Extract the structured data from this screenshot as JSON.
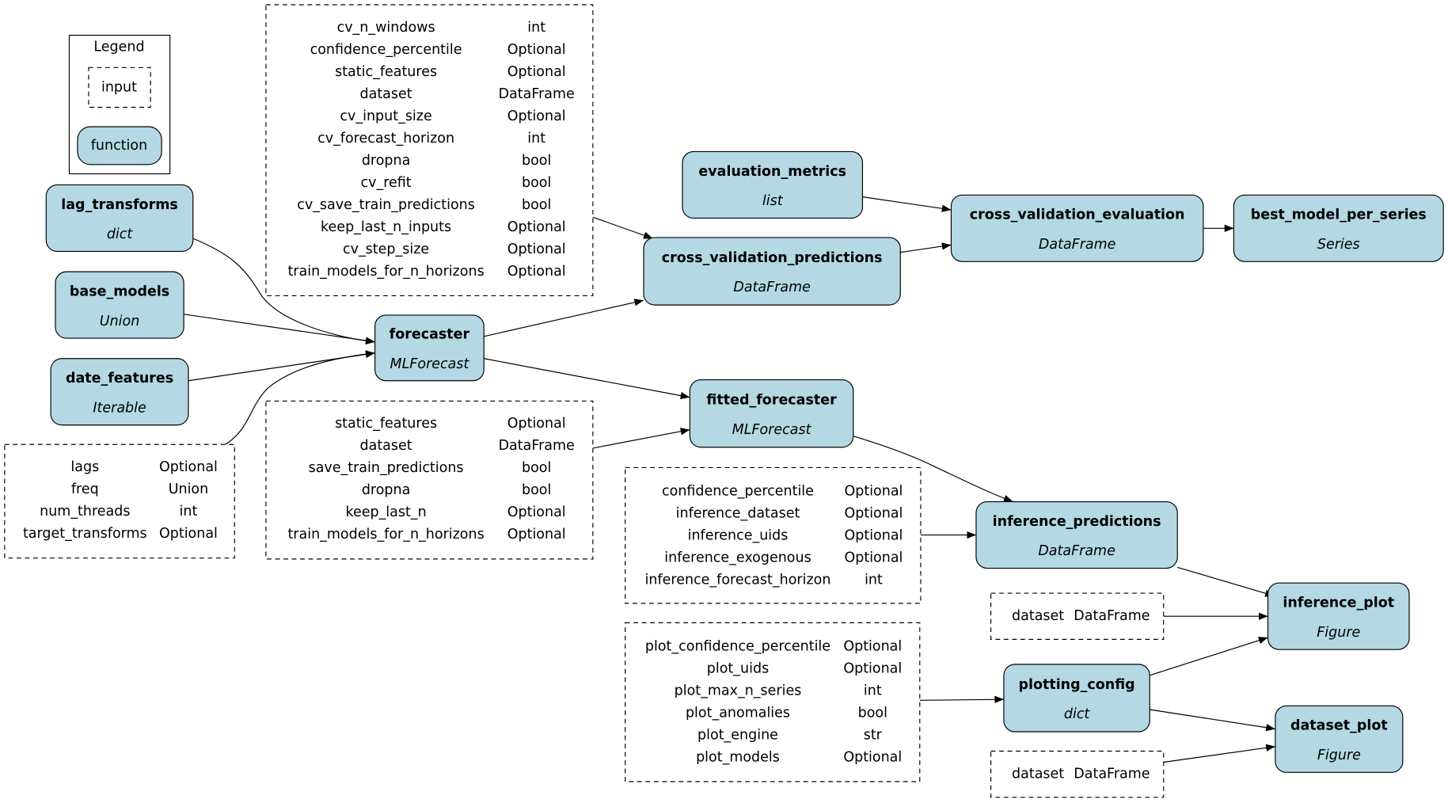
{
  "legend": {
    "title": "Legend",
    "input": "input",
    "function": "function"
  },
  "colors": {
    "function_fill": "#b4d8e4",
    "input_border": "#000000"
  },
  "nodes": {
    "lag_transforms": {
      "name": "lag_transforms",
      "type": "dict"
    },
    "base_models": {
      "name": "base_models",
      "type": "Union"
    },
    "date_features": {
      "name": "date_features",
      "type": "Iterable"
    },
    "forecaster": {
      "name": "forecaster",
      "type": "MLForecast"
    },
    "evaluation_metrics": {
      "name": "evaluation_metrics",
      "type": "list"
    },
    "cross_validation_predictions": {
      "name": "cross_validation_predictions",
      "type": "DataFrame"
    },
    "cross_validation_evaluation": {
      "name": "cross_validation_evaluation",
      "type": "DataFrame"
    },
    "best_model_per_series": {
      "name": "best_model_per_series",
      "type": "Series"
    },
    "fitted_forecaster": {
      "name": "fitted_forecaster",
      "type": "MLForecast"
    },
    "inference_predictions": {
      "name": "inference_predictions",
      "type": "DataFrame"
    },
    "inference_plot": {
      "name": "inference_plot",
      "type": "Figure"
    },
    "plotting_config": {
      "name": "plotting_config",
      "type": "dict"
    },
    "dataset_plot": {
      "name": "dataset_plot",
      "type": "Figure"
    }
  },
  "inputs": {
    "cv": [
      [
        "cv_n_windows",
        "int"
      ],
      [
        "confidence_percentile",
        "Optional"
      ],
      [
        "static_features",
        "Optional"
      ],
      [
        "dataset",
        "DataFrame"
      ],
      [
        "cv_input_size",
        "Optional"
      ],
      [
        "cv_forecast_horizon",
        "int"
      ],
      [
        "dropna",
        "bool"
      ],
      [
        "cv_refit",
        "bool"
      ],
      [
        "cv_save_train_predictions",
        "bool"
      ],
      [
        "keep_last_n_inputs",
        "Optional"
      ],
      [
        "cv_step_size",
        "Optional"
      ],
      [
        "train_models_for_n_horizons",
        "Optional"
      ]
    ],
    "forecaster": [
      [
        "lags",
        "Optional"
      ],
      [
        "freq",
        "Union"
      ],
      [
        "num_threads",
        "int"
      ],
      [
        "target_transforms",
        "Optional"
      ]
    ],
    "fit": [
      [
        "static_features",
        "Optional"
      ],
      [
        "dataset",
        "DataFrame"
      ],
      [
        "save_train_predictions",
        "bool"
      ],
      [
        "dropna",
        "bool"
      ],
      [
        "keep_last_n",
        "Optional"
      ],
      [
        "train_models_for_n_horizons",
        "Optional"
      ]
    ],
    "inference": [
      [
        "confidence_percentile",
        "Optional"
      ],
      [
        "inference_dataset",
        "Optional"
      ],
      [
        "inference_uids",
        "Optional"
      ],
      [
        "inference_exogenous",
        "Optional"
      ],
      [
        "inference_forecast_horizon",
        "int"
      ]
    ],
    "plot": [
      [
        "plot_confidence_percentile",
        "Optional"
      ],
      [
        "plot_uids",
        "Optional"
      ],
      [
        "plot_max_n_series",
        "int"
      ],
      [
        "plot_anomalies",
        "bool"
      ],
      [
        "plot_engine",
        "str"
      ],
      [
        "plot_models",
        "Optional"
      ]
    ],
    "inference_plot_dataset": [
      [
        "dataset",
        "DataFrame"
      ]
    ],
    "dataset_plot_dataset": [
      [
        "dataset",
        "DataFrame"
      ]
    ]
  }
}
